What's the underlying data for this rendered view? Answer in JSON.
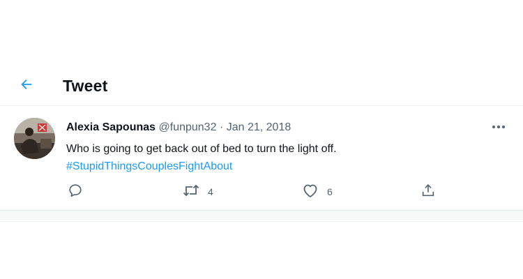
{
  "header": {
    "title": "Tweet",
    "back_icon": "arrow-left-icon",
    "accent_color": "#1d9bf0"
  },
  "tweet": {
    "author_name": "Alexia Sapounas",
    "author_handle": "@funpun32",
    "separator": "·",
    "date": "Jan 21, 2018",
    "text": "Who is going to get back out of bed to turn the light off.",
    "hashtag": "#StupidThingsCouplesFightAbout",
    "more_icon": "more-horizontal-icon",
    "actions": {
      "reply": {
        "icon": "reply-icon",
        "count": ""
      },
      "retweet": {
        "icon": "retweet-icon",
        "count": "4"
      },
      "like": {
        "icon": "heart-icon",
        "count": "6"
      },
      "share": {
        "icon": "share-icon",
        "count": ""
      }
    }
  }
}
